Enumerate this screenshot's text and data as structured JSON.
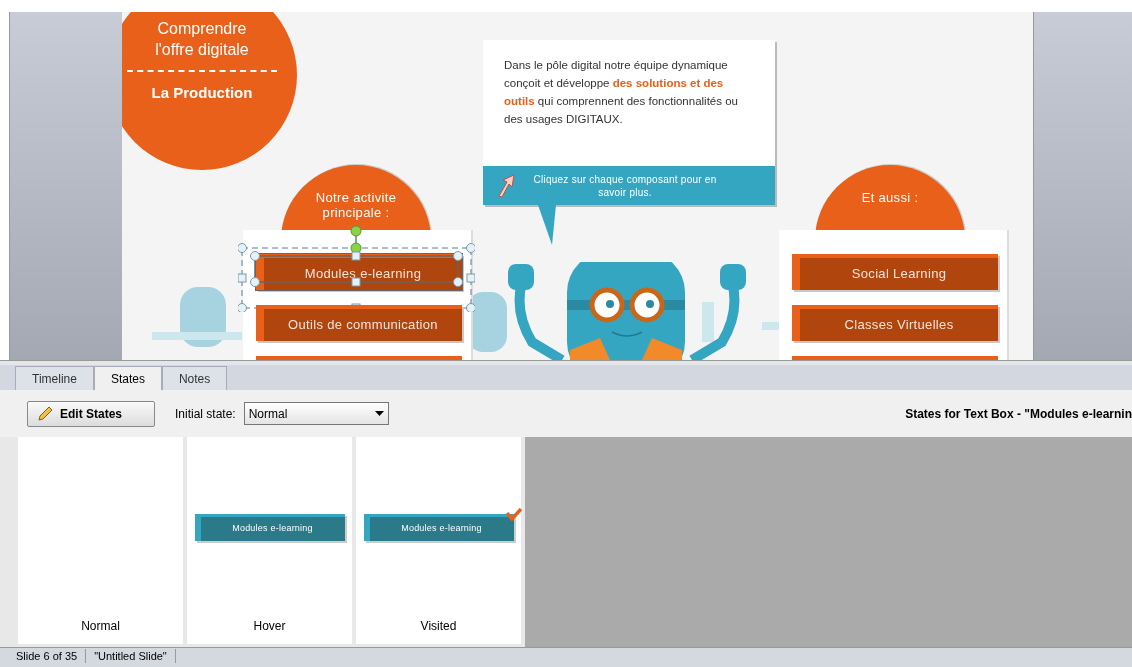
{
  "slide": {
    "header": {
      "title": "Comprendre l'offre digitale",
      "subtitle": "La Production"
    },
    "bubble": {
      "text": "Dans le pôle digital notre équipe dynamique conçoit et développe **des solutions et des outils** qui comprennent des fonctionnalités ou des usages DIGITAUX.",
      "hint": "Cliquez sur chaque composant pour en savoir plus."
    },
    "groups": [
      {
        "heading": "Notre activite principale :",
        "buttons": [
          {
            "label": "Modules e-learning",
            "selected": true
          },
          {
            "label": "Outils de communication",
            "selected": false
          }
        ]
      },
      {
        "heading": "Et aussi :",
        "buttons": [
          {
            "label": "Social Learning",
            "selected": false
          },
          {
            "label": "Classes Virtuelles",
            "selected": false
          }
        ]
      }
    ]
  },
  "tabs": [
    {
      "label": "Timeline",
      "selected": false
    },
    {
      "label": "States",
      "selected": true
    },
    {
      "label": "Notes",
      "selected": false
    }
  ],
  "toolbar": {
    "edit_button": "Edit States",
    "initial_state_label": "Initial state:",
    "initial_state_value": "Normal",
    "title": "States for Text Box - \"Modules e-learnin"
  },
  "states": [
    {
      "label": "Normal",
      "kind": "empty"
    },
    {
      "label": "Hover",
      "kind": "button",
      "thumb_text": "Modules e-learning",
      "checked": false
    },
    {
      "label": "Visited",
      "kind": "button",
      "thumb_text": "Modules e-learning",
      "checked": true
    }
  ],
  "status_bar": [
    "Slide 6 of 35",
    "\"Untitled Slide\""
  ]
}
